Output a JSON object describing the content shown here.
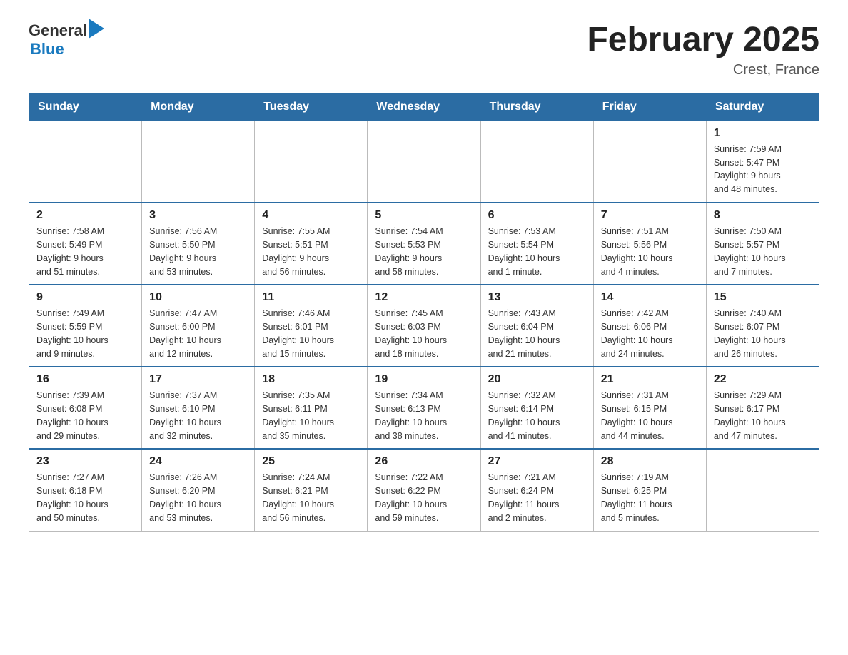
{
  "header": {
    "logo_general": "General",
    "logo_blue": "Blue",
    "title": "February 2025",
    "subtitle": "Crest, France"
  },
  "days_of_week": [
    "Sunday",
    "Monday",
    "Tuesday",
    "Wednesday",
    "Thursday",
    "Friday",
    "Saturday"
  ],
  "weeks": [
    [
      {
        "day": "",
        "info": ""
      },
      {
        "day": "",
        "info": ""
      },
      {
        "day": "",
        "info": ""
      },
      {
        "day": "",
        "info": ""
      },
      {
        "day": "",
        "info": ""
      },
      {
        "day": "",
        "info": ""
      },
      {
        "day": "1",
        "info": "Sunrise: 7:59 AM\nSunset: 5:47 PM\nDaylight: 9 hours\nand 48 minutes."
      }
    ],
    [
      {
        "day": "2",
        "info": "Sunrise: 7:58 AM\nSunset: 5:49 PM\nDaylight: 9 hours\nand 51 minutes."
      },
      {
        "day": "3",
        "info": "Sunrise: 7:56 AM\nSunset: 5:50 PM\nDaylight: 9 hours\nand 53 minutes."
      },
      {
        "day": "4",
        "info": "Sunrise: 7:55 AM\nSunset: 5:51 PM\nDaylight: 9 hours\nand 56 minutes."
      },
      {
        "day": "5",
        "info": "Sunrise: 7:54 AM\nSunset: 5:53 PM\nDaylight: 9 hours\nand 58 minutes."
      },
      {
        "day": "6",
        "info": "Sunrise: 7:53 AM\nSunset: 5:54 PM\nDaylight: 10 hours\nand 1 minute."
      },
      {
        "day": "7",
        "info": "Sunrise: 7:51 AM\nSunset: 5:56 PM\nDaylight: 10 hours\nand 4 minutes."
      },
      {
        "day": "8",
        "info": "Sunrise: 7:50 AM\nSunset: 5:57 PM\nDaylight: 10 hours\nand 7 minutes."
      }
    ],
    [
      {
        "day": "9",
        "info": "Sunrise: 7:49 AM\nSunset: 5:59 PM\nDaylight: 10 hours\nand 9 minutes."
      },
      {
        "day": "10",
        "info": "Sunrise: 7:47 AM\nSunset: 6:00 PM\nDaylight: 10 hours\nand 12 minutes."
      },
      {
        "day": "11",
        "info": "Sunrise: 7:46 AM\nSunset: 6:01 PM\nDaylight: 10 hours\nand 15 minutes."
      },
      {
        "day": "12",
        "info": "Sunrise: 7:45 AM\nSunset: 6:03 PM\nDaylight: 10 hours\nand 18 minutes."
      },
      {
        "day": "13",
        "info": "Sunrise: 7:43 AM\nSunset: 6:04 PM\nDaylight: 10 hours\nand 21 minutes."
      },
      {
        "day": "14",
        "info": "Sunrise: 7:42 AM\nSunset: 6:06 PM\nDaylight: 10 hours\nand 24 minutes."
      },
      {
        "day": "15",
        "info": "Sunrise: 7:40 AM\nSunset: 6:07 PM\nDaylight: 10 hours\nand 26 minutes."
      }
    ],
    [
      {
        "day": "16",
        "info": "Sunrise: 7:39 AM\nSunset: 6:08 PM\nDaylight: 10 hours\nand 29 minutes."
      },
      {
        "day": "17",
        "info": "Sunrise: 7:37 AM\nSunset: 6:10 PM\nDaylight: 10 hours\nand 32 minutes."
      },
      {
        "day": "18",
        "info": "Sunrise: 7:35 AM\nSunset: 6:11 PM\nDaylight: 10 hours\nand 35 minutes."
      },
      {
        "day": "19",
        "info": "Sunrise: 7:34 AM\nSunset: 6:13 PM\nDaylight: 10 hours\nand 38 minutes."
      },
      {
        "day": "20",
        "info": "Sunrise: 7:32 AM\nSunset: 6:14 PM\nDaylight: 10 hours\nand 41 minutes."
      },
      {
        "day": "21",
        "info": "Sunrise: 7:31 AM\nSunset: 6:15 PM\nDaylight: 10 hours\nand 44 minutes."
      },
      {
        "day": "22",
        "info": "Sunrise: 7:29 AM\nSunset: 6:17 PM\nDaylight: 10 hours\nand 47 minutes."
      }
    ],
    [
      {
        "day": "23",
        "info": "Sunrise: 7:27 AM\nSunset: 6:18 PM\nDaylight: 10 hours\nand 50 minutes."
      },
      {
        "day": "24",
        "info": "Sunrise: 7:26 AM\nSunset: 6:20 PM\nDaylight: 10 hours\nand 53 minutes."
      },
      {
        "day": "25",
        "info": "Sunrise: 7:24 AM\nSunset: 6:21 PM\nDaylight: 10 hours\nand 56 minutes."
      },
      {
        "day": "26",
        "info": "Sunrise: 7:22 AM\nSunset: 6:22 PM\nDaylight: 10 hours\nand 59 minutes."
      },
      {
        "day": "27",
        "info": "Sunrise: 7:21 AM\nSunset: 6:24 PM\nDaylight: 11 hours\nand 2 minutes."
      },
      {
        "day": "28",
        "info": "Sunrise: 7:19 AM\nSunset: 6:25 PM\nDaylight: 11 hours\nand 5 minutes."
      },
      {
        "day": "",
        "info": ""
      }
    ]
  ]
}
